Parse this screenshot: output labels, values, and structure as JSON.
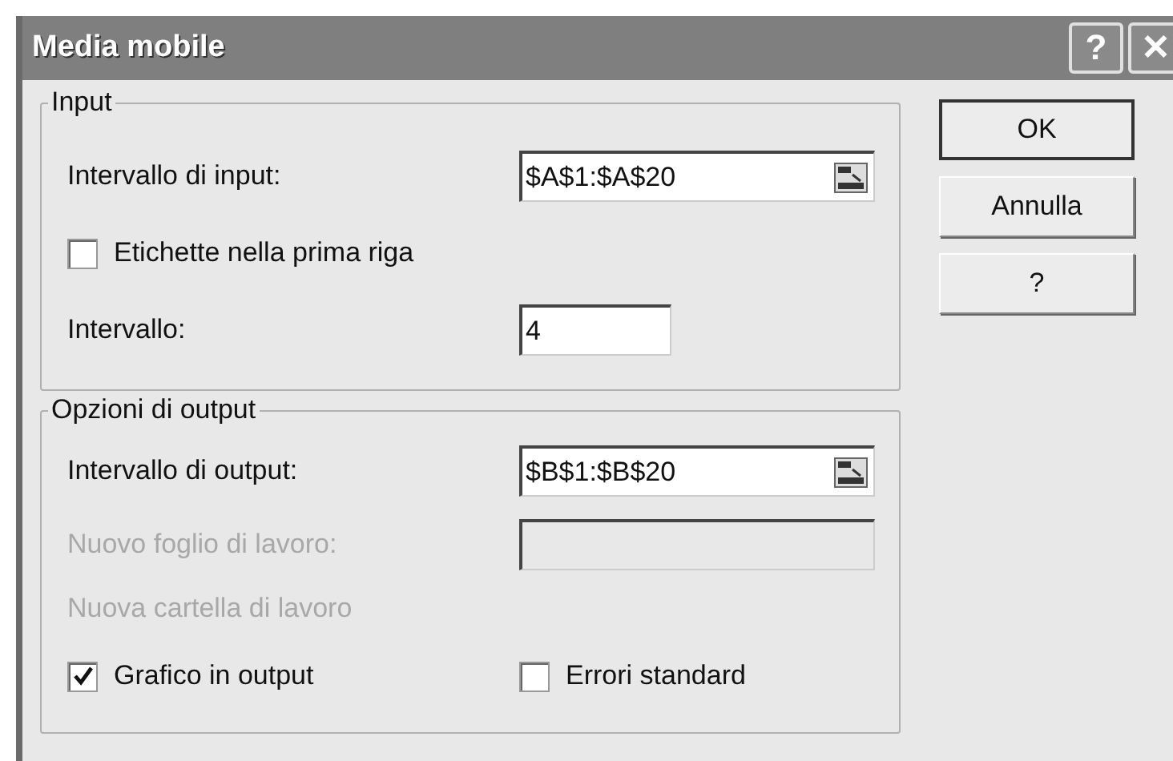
{
  "window": {
    "title": "Media mobile",
    "title_buttons": [
      "?",
      "✕"
    ]
  },
  "groups": [
    {
      "title": "Input",
      "rows": [
        {
          "kind": "range_field",
          "label": "Intervallo di input:",
          "value": "$A$1:$A$20",
          "disabled": false
        },
        {
          "kind": "checkboxes",
          "items": [
            {
              "label": "Etichette nella prima riga",
              "checked": false
            }
          ]
        },
        {
          "kind": "number_field",
          "label": "Intervallo:",
          "value": "4",
          "disabled": false
        }
      ]
    },
    {
      "title": "Opzioni di output",
      "rows": [
        {
          "kind": "range_field",
          "label": "Intervallo di output:",
          "value": "$B$1:$B$20",
          "disabled": false
        },
        {
          "kind": "text_field",
          "label": "Nuovo foglio di lavoro:",
          "disabled": true
        },
        {
          "kind": "label",
          "label": "Nuova cartella di lavoro",
          "disabled": true
        },
        {
          "kind": "checkboxes",
          "items": [
            {
              "label": "Grafico in output",
              "checked": true
            },
            {
              "label": "Errori standard",
              "checked": false
            }
          ]
        }
      ]
    }
  ],
  "buttons": [
    {
      "label": "OK",
      "default": true
    },
    {
      "label": "Annulla",
      "default": false
    },
    {
      "label": "?",
      "default": false
    }
  ]
}
